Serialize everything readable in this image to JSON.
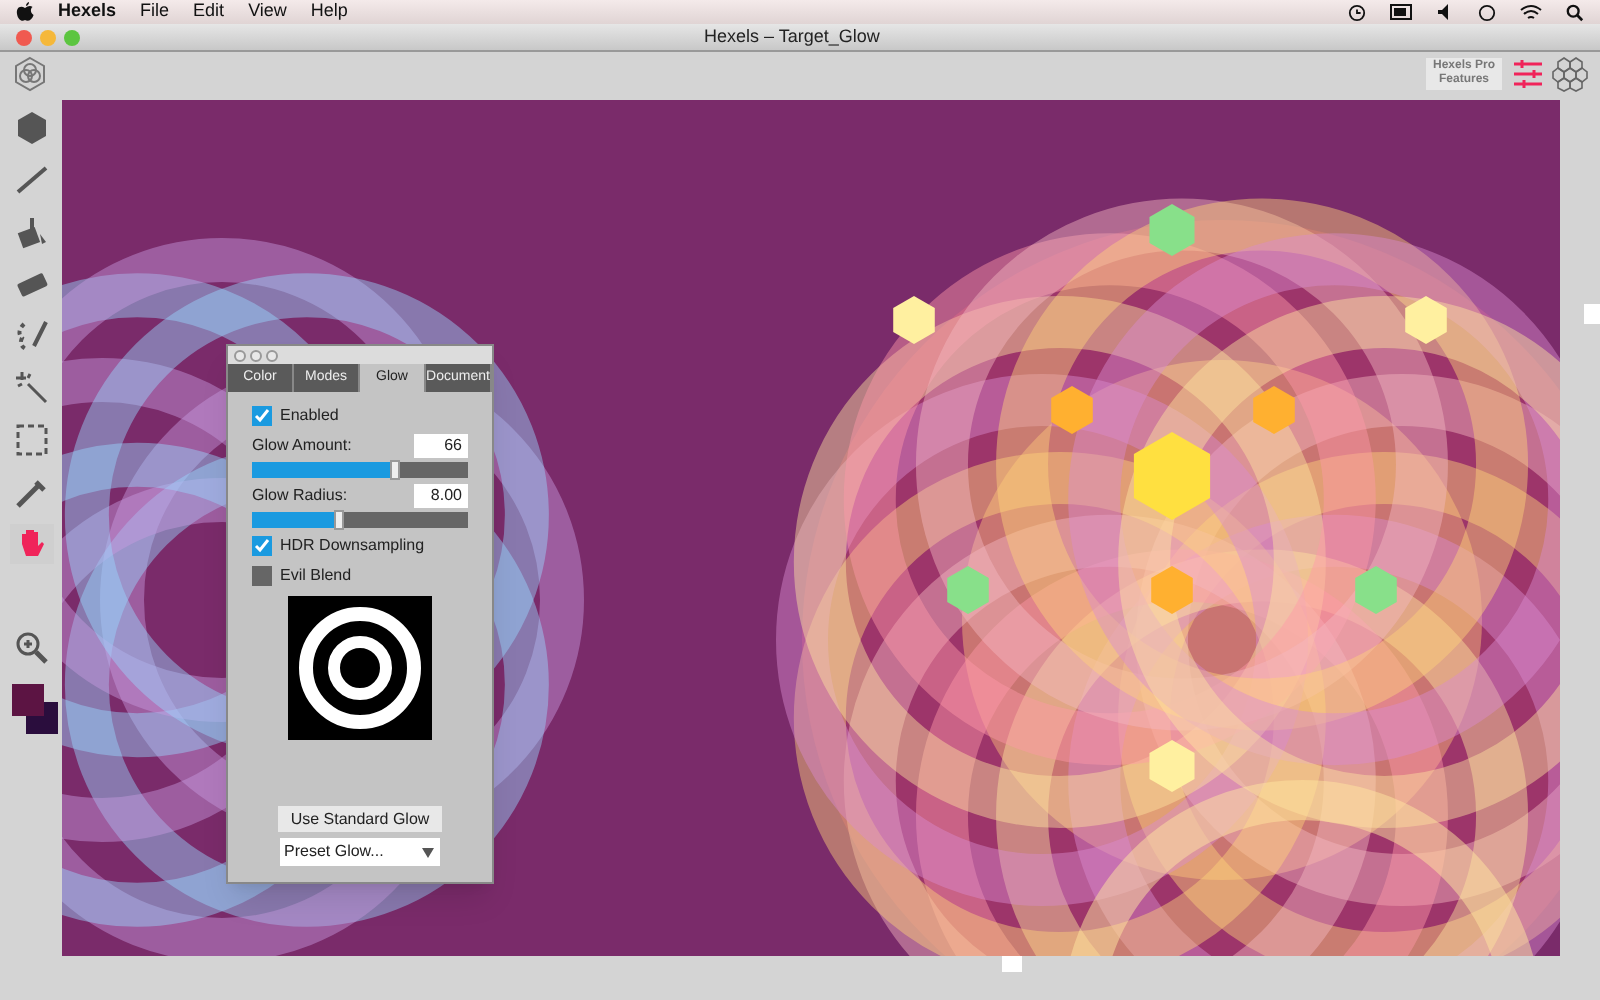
{
  "menu_bar": {
    "app": "Hexels",
    "items": [
      "File",
      "Edit",
      "View",
      "Help"
    ]
  },
  "window": {
    "title": "Hexels – Target_Glow"
  },
  "toolbar": {
    "pro_button": "Hexels Pro Features"
  },
  "tools": [
    {
      "kind": "hexagon",
      "selected": false
    },
    {
      "kind": "line",
      "selected": false
    },
    {
      "kind": "bucket",
      "selected": false
    },
    {
      "kind": "eraser",
      "selected": false
    },
    {
      "kind": "lasso",
      "selected": false
    },
    {
      "kind": "wand",
      "selected": false
    },
    {
      "kind": "marquee",
      "selected": false
    },
    {
      "kind": "eyedropper",
      "selected": false
    },
    {
      "kind": "hand",
      "selected": true
    },
    {
      "kind": "zoom",
      "selected": false
    }
  ],
  "swatches": [
    {
      "color": "#5c1443"
    },
    {
      "color": "#2a0d3d"
    }
  ],
  "glow_panel": {
    "tabs": [
      {
        "label": "Color",
        "selected": false
      },
      {
        "label": "Modes",
        "selected": false
      },
      {
        "label": "Glow",
        "selected": true
      },
      {
        "label": "Document",
        "selected": false
      }
    ],
    "enabled": {
      "label": "Enabled",
      "checked": true
    },
    "sliders": [
      {
        "label": "Glow Amount:",
        "value": "66",
        "level": 0.66
      },
      {
        "label": "Glow Radius:",
        "value": "8.00",
        "level": 0.4
      }
    ],
    "hdr": {
      "label": "HDR Downsampling",
      "checked": true
    },
    "evil_blend": {
      "label": "Evil Blend",
      "checked": false
    },
    "button": "Use Standard Glow",
    "preset": {
      "value": "Preset Glow..."
    }
  }
}
